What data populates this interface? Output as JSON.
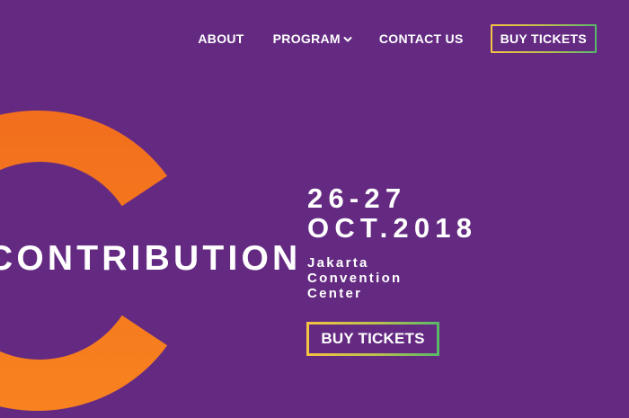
{
  "nav": {
    "about": "ABOUT",
    "program": "PROGRAM",
    "contact": "CONTACT US",
    "tickets": "BUY TICKETS"
  },
  "hero": {
    "word": "CONTRIBUTION",
    "date_line1": "26-27",
    "date_line2": "OCT.2018",
    "venue_line1": "Jakarta",
    "venue_line2": "Convention",
    "venue_line3": "Center",
    "cta": "BUY TICKETS"
  },
  "colors": {
    "background": "#642a82",
    "accent_orange": "#f57a1f",
    "border_gradient_start": "#f6c243",
    "border_gradient_end": "#58b86a",
    "text": "#ffffff"
  },
  "icons": {
    "program_dropdown": "chevron-down-icon"
  }
}
